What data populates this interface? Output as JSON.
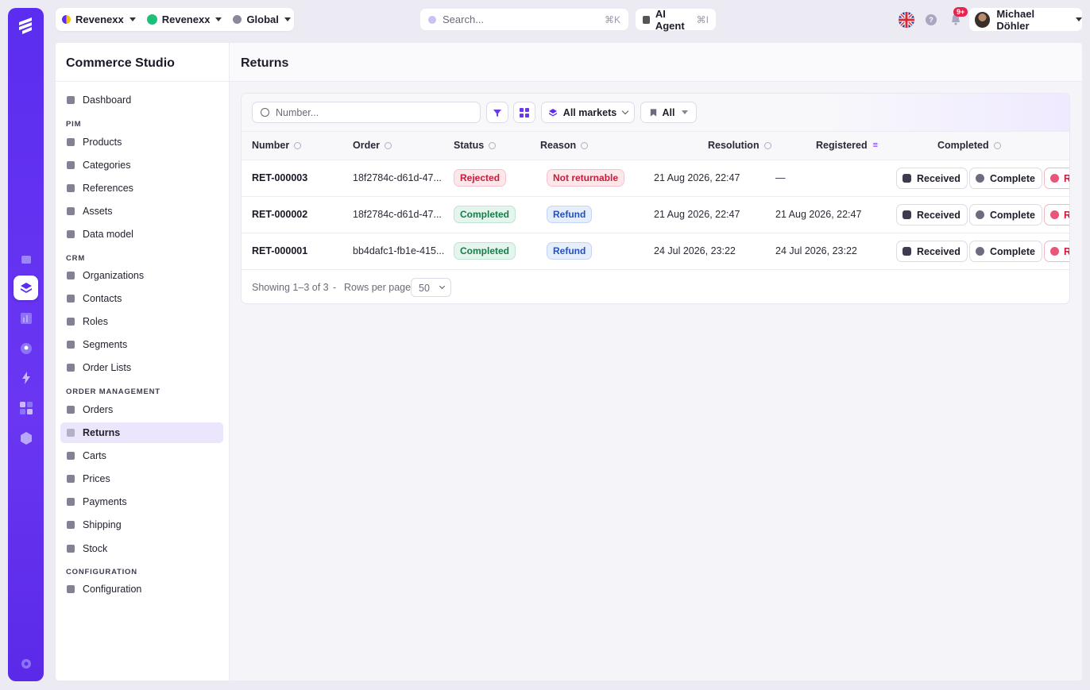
{
  "topbar": {
    "org1": "Revenexx",
    "org2": "Revenexx",
    "scope": "Global",
    "search_placeholder": "Search...",
    "search_shortcut": "⌘K",
    "ai_label": "AI Agent",
    "ai_shortcut": "⌘I",
    "notifications_badge": "9+",
    "user_name": "Michael Döhler",
    "help": "?"
  },
  "sidebar": {
    "title": "Commerce Studio",
    "dashboard": "Dashboard",
    "sec_pim": "PIM",
    "products": "Products",
    "categories": "Categories",
    "references": "References",
    "assets": "Assets",
    "data_model": "Data model",
    "sec_crm": "CRM",
    "organizations": "Organizations",
    "contacts": "Contacts",
    "roles": "Roles",
    "segments": "Segments",
    "order_lists": "Order Lists",
    "sec_order": "ORDER MANAGEMENT",
    "orders": "Orders",
    "returns": "Returns",
    "carts": "Carts",
    "prices": "Prices",
    "payments": "Payments",
    "shipping": "Shipping",
    "stock": "Stock",
    "sec_config": "CONFIGURATION",
    "configuration": "Configuration"
  },
  "main": {
    "title": "Returns",
    "search_placeholder": "Number...",
    "markets_label": "All markets",
    "all_label": "All",
    "columns": {
      "number": "Number",
      "order": "Order",
      "status": "Status",
      "reason": "Reason",
      "resolution": "Resolution",
      "registered": "Registered",
      "completed": "Completed"
    },
    "rows": [
      {
        "number": "RET-000003",
        "order": "18f2784c-d61d-47...",
        "status": "Rejected",
        "reason": "Not returnable",
        "registered": "21 Aug 2026, 22:47",
        "completed": "—"
      },
      {
        "number": "RET-000002",
        "order": "18f2784c-d61d-47...",
        "status": "Completed",
        "reason": "Refund",
        "registered": "21 Aug 2026, 22:47",
        "completed": "21 Aug 2026, 22:47"
      },
      {
        "number": "RET-000001",
        "order": "bb4dafc1-fb1e-415...",
        "status": "Completed",
        "reason": "Refund",
        "registered": "24 Jul 2026, 23:22",
        "completed": "24 Jul 2026, 23:22"
      }
    ],
    "actions": {
      "received": "Received",
      "complete": "Complete",
      "reject": "R"
    },
    "footer": {
      "showing": "Showing 1–3 of 3",
      "sep": "-",
      "rows_per_page": "Rows per page",
      "rows_value": "50"
    }
  },
  "colors": {
    "accent": "#5b2df0",
    "rejected": "#c61d3a",
    "completed": "#1a7a4a",
    "refund": "#2450c2"
  }
}
